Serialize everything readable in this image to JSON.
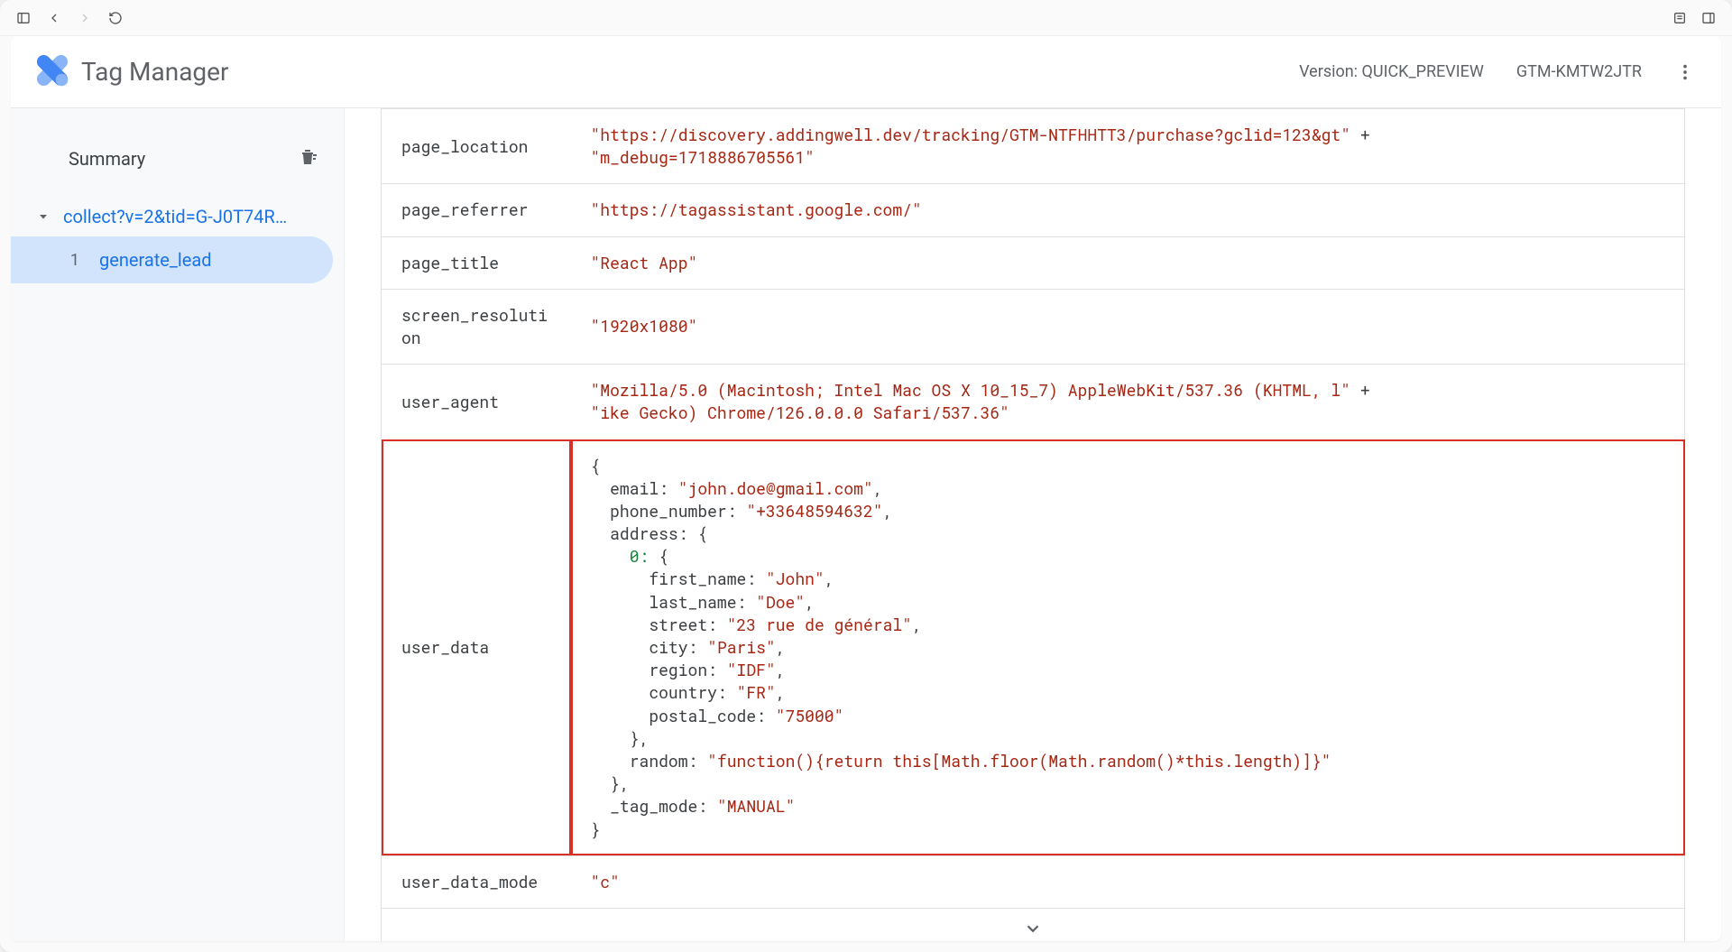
{
  "app": {
    "title": "Tag Manager",
    "version_label": "Version: QUICK_PREVIEW",
    "container_id": "GTM-KMTW2JTR"
  },
  "sidebar": {
    "summary_label": "Summary",
    "request": {
      "label": "collect?v=2&tid=G-J0T74R…"
    },
    "events": [
      {
        "index": "1",
        "name": "generate_lead"
      }
    ]
  },
  "rows": {
    "page_location": {
      "key": "page_location",
      "parts": [
        "\"https://discovery.addingwell.dev/tracking/GTM-NTFHHTT3/purchase?gclid=123&gt\"",
        "\"m_debug=1718886705561\""
      ]
    },
    "page_referrer": {
      "key": "page_referrer",
      "value": "\"https://tagassistant.google.com/\""
    },
    "page_title": {
      "key": "page_title",
      "value": "\"React App\""
    },
    "screen_resolution": {
      "key": "screen_resolution",
      "value": "\"1920x1080\""
    },
    "user_agent": {
      "key": "user_agent",
      "parts": [
        "\"Mozilla/5.0 (Macintosh; Intel Mac OS X 10_15_7) AppleWebKit/537.36 (KHTML, l\"",
        "\"ike Gecko) Chrome/126.0.0.0 Safari/537.36\""
      ]
    },
    "user_data": {
      "key": "user_data",
      "object": {
        "email": "\"john.doe@gmail.com\"",
        "phone_number": "\"+33648594632\"",
        "address_first_name": "\"John\"",
        "address_last_name": "\"Doe\"",
        "address_street": "\"23 rue de général\"",
        "address_city": "\"Paris\"",
        "address_region": "\"IDF\"",
        "address_country": "\"FR\"",
        "address_postal_code": "\"75000\"",
        "address_random": "\"function(){return this[Math.floor(Math.random()*this.length)]}\"",
        "tag_mode": "\"MANUAL\""
      }
    },
    "user_data_mode": {
      "key": "user_data_mode",
      "value": "\"c\""
    }
  }
}
